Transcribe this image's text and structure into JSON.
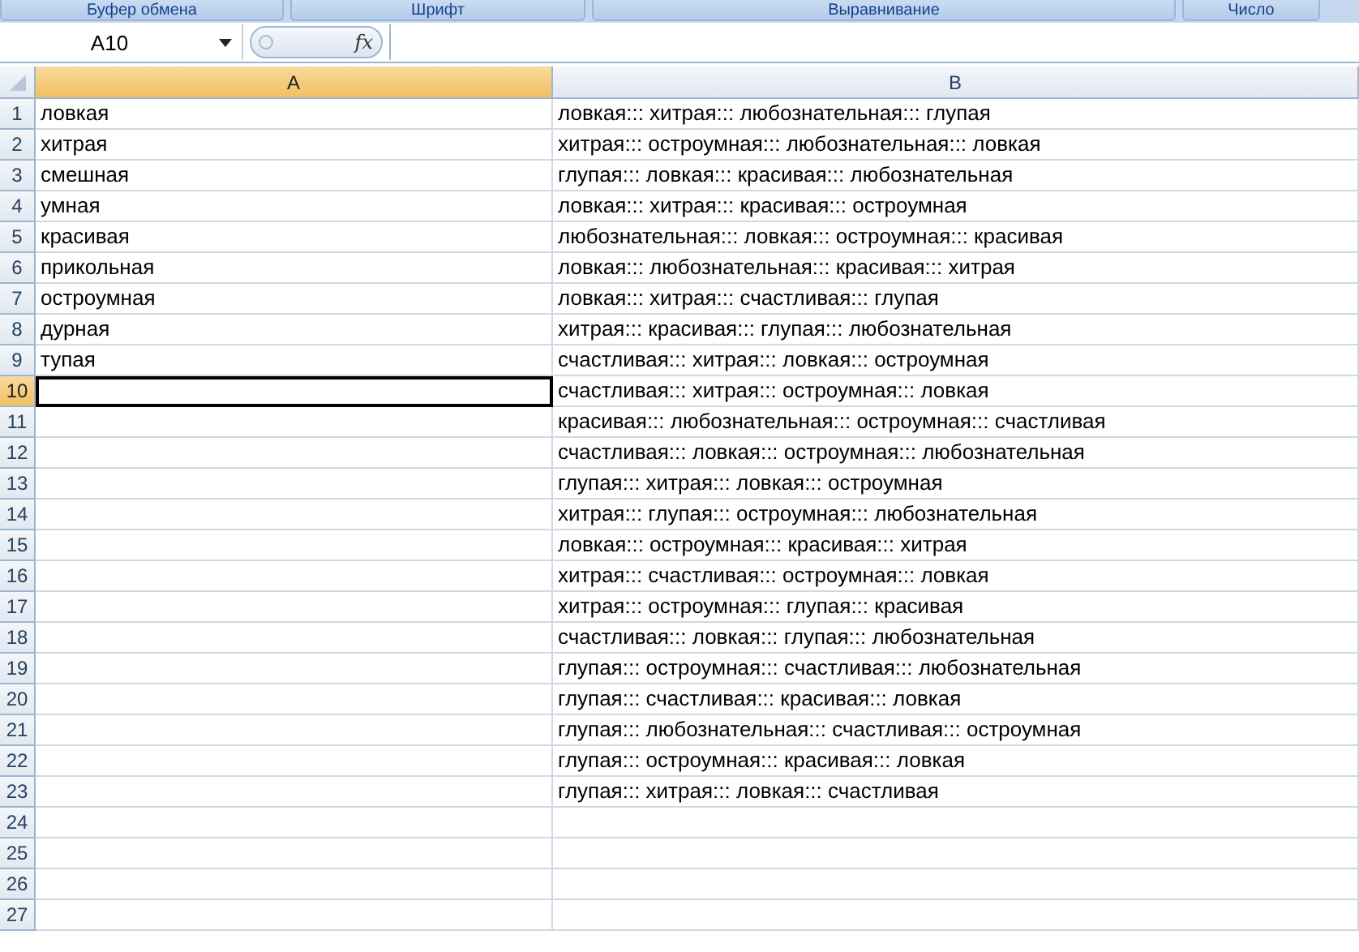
{
  "ribbon_groups": [
    {
      "label": "Буфер обмена"
    },
    {
      "label": "Шрифт"
    },
    {
      "label": "Выравнивание"
    },
    {
      "label": "Число"
    }
  ],
  "name_box": {
    "value": "A10"
  },
  "formula_bar": {
    "function_label": "fx"
  },
  "columns": [
    {
      "label": "A",
      "selected": true
    },
    {
      "label": "B",
      "selected": false
    }
  ],
  "rows": [
    {
      "number": "1",
      "selected": false,
      "a": "ловкая",
      "b": "ловкая::: хитрая::: любознательная::: глупая"
    },
    {
      "number": "2",
      "selected": false,
      "a": "хитрая",
      "b": "хитрая::: остроумная::: любознательная::: ловкая"
    },
    {
      "number": "3",
      "selected": false,
      "a": "смешная",
      "b": "глупая::: ловкая::: красивая::: любознательная"
    },
    {
      "number": "4",
      "selected": false,
      "a": "умная",
      "b": "ловкая::: хитрая::: красивая::: остроумная"
    },
    {
      "number": "5",
      "selected": false,
      "a": "красивая",
      "b": "любознательная::: ловкая::: остроумная::: красивая"
    },
    {
      "number": "6",
      "selected": false,
      "a": "прикольная",
      "b": "ловкая::: любознательная::: красивая::: хитрая"
    },
    {
      "number": "7",
      "selected": false,
      "a": "остроумная",
      "b": "ловкая::: хитрая::: счастливая::: глупая"
    },
    {
      "number": "8",
      "selected": false,
      "a": "дурная",
      "b": "хитрая::: красивая::: глупая::: любознательная"
    },
    {
      "number": "9",
      "selected": false,
      "a": "тупая",
      "b": "счастливая::: хитрая::: ловкая::: остроумная"
    },
    {
      "number": "10",
      "selected": true,
      "b": "счастливая::: хитрая::: остроумная::: ловкая"
    },
    {
      "number": "11",
      "selected": false,
      "b": "красивая::: любознательная::: остроумная::: счастливая"
    },
    {
      "number": "12",
      "selected": false,
      "b": "счастливая::: ловкая::: остроумная::: любознательная"
    },
    {
      "number": "13",
      "selected": false,
      "b": "глупая::: хитрая::: ловкая::: остроумная"
    },
    {
      "number": "14",
      "selected": false,
      "b": "хитрая::: глупая::: остроумная::: любознательная"
    },
    {
      "number": "15",
      "selected": false,
      "b": "ловкая::: остроумная::: красивая::: хитрая"
    },
    {
      "number": "16",
      "selected": false,
      "b": "хитрая::: счастливая::: остроумная::: ловкая"
    },
    {
      "number": "17",
      "selected": false,
      "b": "хитрая::: остроумная::: глупая::: красивая"
    },
    {
      "number": "18",
      "selected": false,
      "b": "счастливая::: ловкая::: глупая::: любознательная"
    },
    {
      "number": "19",
      "selected": false,
      "b": "глупая::: остроумная::: счастливая::: любознательная"
    },
    {
      "number": "20",
      "selected": false,
      "b": "глупая::: счастливая::: красивая::: ловкая"
    },
    {
      "number": "21",
      "selected": false,
      "b": "глупая::: любознательная::: счастливая::: остроумная"
    },
    {
      "number": "22",
      "selected": false,
      "b": "глупая::: остроумная::: красивая::: ловкая"
    },
    {
      "number": "23",
      "selected": false,
      "b": "глупая::: хитрая::: ловкая::: счастливая"
    },
    {
      "number": "24",
      "selected": false
    },
    {
      "number": "25",
      "selected": false
    },
    {
      "number": "26",
      "selected": false
    },
    {
      "number": "27",
      "selected": false
    }
  ]
}
